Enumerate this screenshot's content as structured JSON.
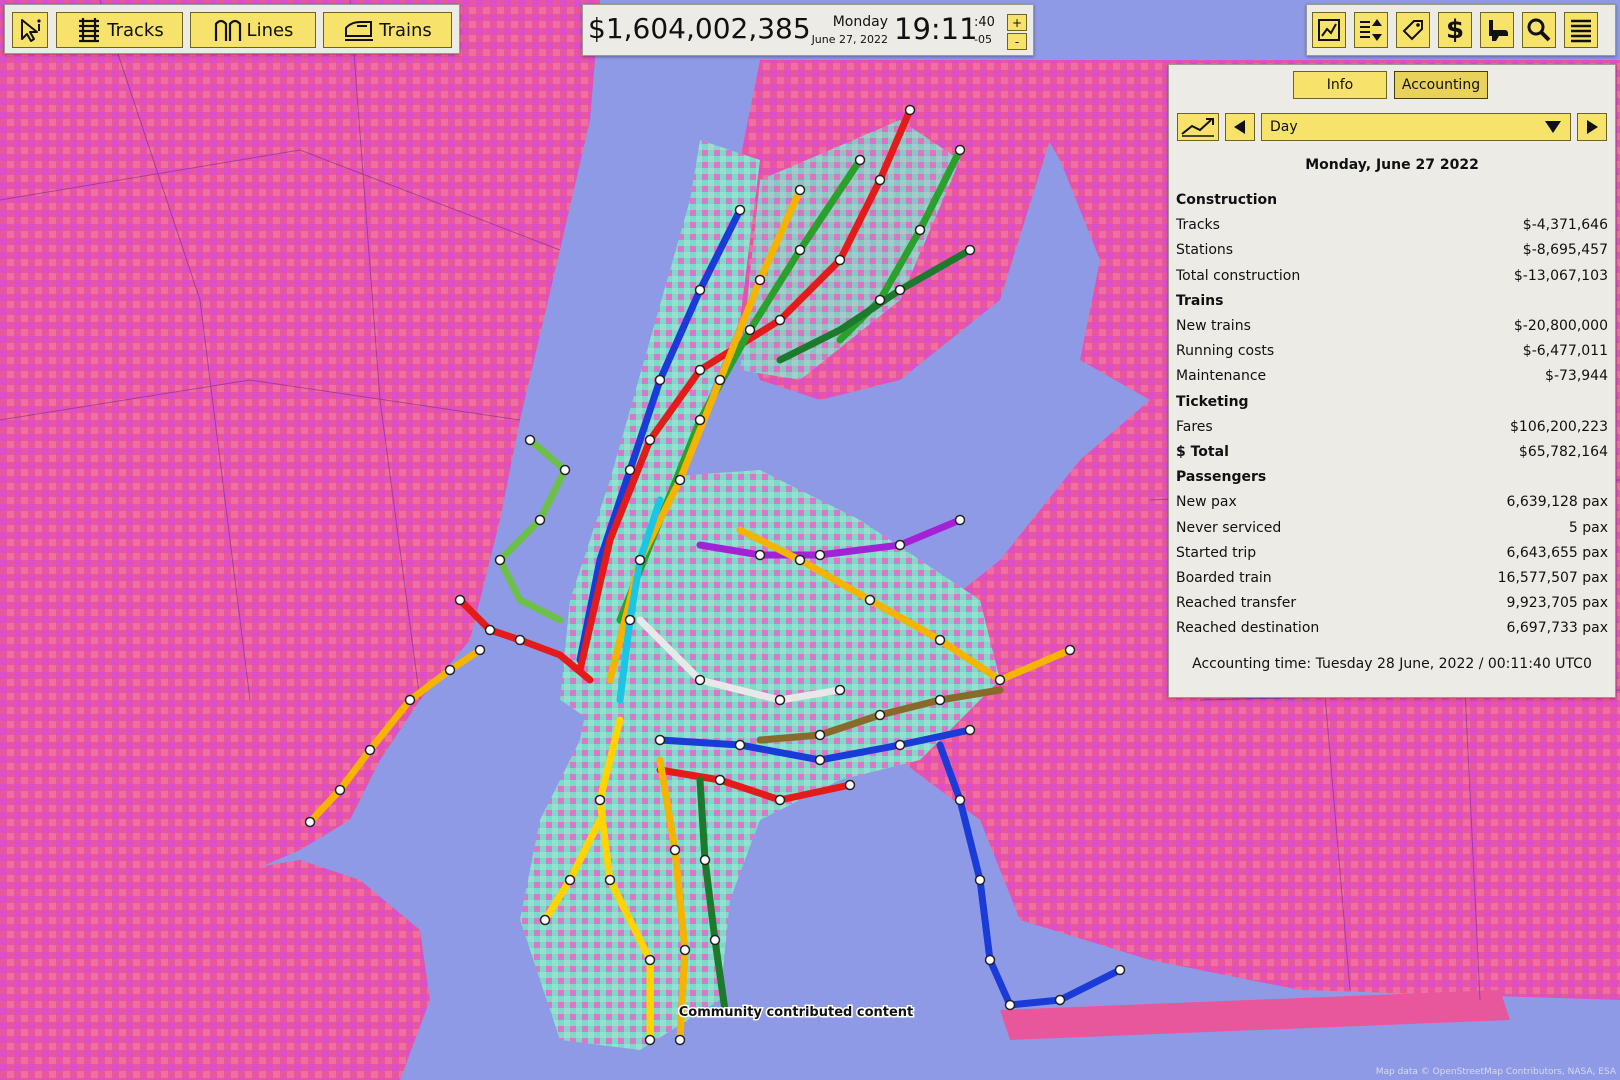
{
  "toolbar": {
    "tracks_label": "Tracks",
    "lines_label": "Lines",
    "trains_label": "Trains"
  },
  "status": {
    "money": "$1,604,002,385",
    "weekday": "Monday",
    "date": "June 27, 2022",
    "time": "19:11",
    "seconds": ":40",
    "timezone": "-05",
    "plus": "+",
    "minus": "-"
  },
  "panel": {
    "tabs": [
      "Info",
      "Accounting"
    ],
    "active_tab": "Accounting",
    "period": "Day",
    "title": "Monday, June 27 2022",
    "rows": [
      {
        "label": "Construction",
        "value": "",
        "header": true
      },
      {
        "label": "Tracks",
        "value": "$-4,371,646"
      },
      {
        "label": "Stations",
        "value": "$-8,695,457"
      },
      {
        "label": "Total construction",
        "value": "$-13,067,103"
      },
      {
        "label": "Trains",
        "value": "",
        "header": true
      },
      {
        "label": "New trains",
        "value": "$-20,800,000"
      },
      {
        "label": "Running costs",
        "value": "$-6,477,011"
      },
      {
        "label": "Maintenance",
        "value": "$-73,944"
      },
      {
        "label": "Ticketing",
        "value": "",
        "header": true
      },
      {
        "label": "Fares",
        "value": "$106,200,223"
      },
      {
        "label": "$ Total",
        "value": "$65,782,164",
        "bold": true
      },
      {
        "label": "Passengers",
        "value": "",
        "header": true
      },
      {
        "label": "New pax",
        "value": "6,639,128 pax"
      },
      {
        "label": "Never serviced",
        "value": "5 pax"
      },
      {
        "label": "Started trip",
        "value": "6,643,655 pax"
      },
      {
        "label": "Boarded train",
        "value": "16,577,507 pax"
      },
      {
        "label": "Reached transfer",
        "value": "9,923,705 pax"
      },
      {
        "label": "Reached destination",
        "value": "6,697,733 pax"
      }
    ],
    "footer": "Accounting time: Tuesday 28 June, 2022 / 00:11:40 UTC0"
  },
  "map": {
    "community_label": "Community contributed content",
    "attribution": "Map data © OpenStreetMap Contributors, NASA, ESA"
  },
  "colors": {
    "land_pink": "#e8579b",
    "land_magenta": "#d84fd4",
    "water": "#8f9ae6",
    "coverage_teal": "#7fd8c8",
    "button_yellow": "#f7e36b",
    "panel_bg": "#ecebe6"
  },
  "icons": [
    "cursor-info-icon",
    "tracks-icon",
    "lines-icon",
    "trains-icon",
    "map-icon",
    "sort-icon",
    "ticket-icon",
    "dollar-icon",
    "build-icon",
    "search-icon",
    "menu-icon",
    "chart-icon",
    "prev-icon",
    "next-icon",
    "dropdown-arrow-icon"
  ]
}
